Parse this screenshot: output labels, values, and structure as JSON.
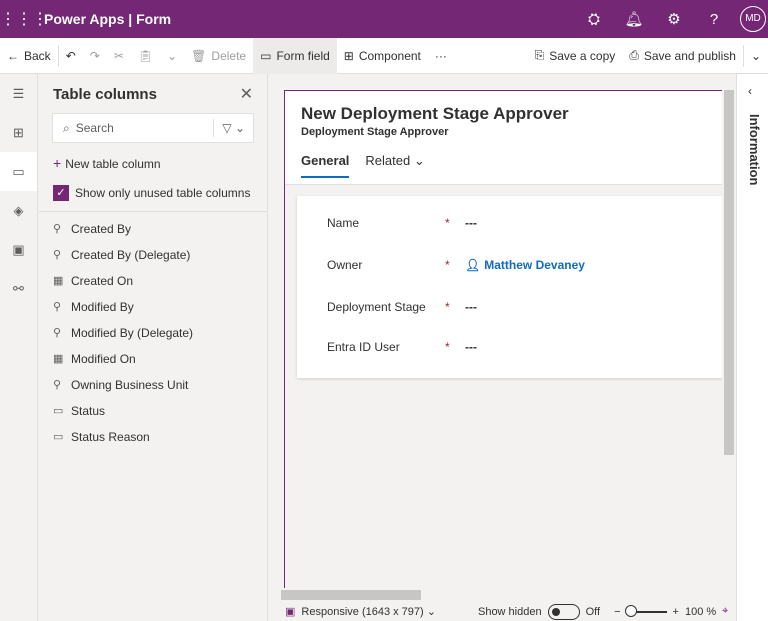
{
  "header": {
    "app": "Power Apps",
    "sep": "|",
    "page": "Form",
    "avatar": "MD"
  },
  "toolbar": {
    "back": "Back",
    "delete": "Delete",
    "form_field": "Form field",
    "component": "Component",
    "more": "···",
    "save_copy": "Save a copy",
    "save_publish": "Save and publish"
  },
  "panel": {
    "title": "Table columns",
    "search_placeholder": "Search",
    "new_column": "New table column",
    "show_unused": "Show only unused table columns",
    "columns": [
      {
        "label": "Created By",
        "icon": "lookup"
      },
      {
        "label": "Created By (Delegate)",
        "icon": "lookup"
      },
      {
        "label": "Created On",
        "icon": "date"
      },
      {
        "label": "Modified By",
        "icon": "lookup"
      },
      {
        "label": "Modified By (Delegate)",
        "icon": "lookup"
      },
      {
        "label": "Modified On",
        "icon": "date"
      },
      {
        "label": "Owning Business Unit",
        "icon": "lookup"
      },
      {
        "label": "Status",
        "icon": "option"
      },
      {
        "label": "Status Reason",
        "icon": "option"
      }
    ]
  },
  "form": {
    "title": "New Deployment Stage Approver",
    "subtitle": "Deployment Stage Approver",
    "tabs": [
      "General",
      "Related"
    ],
    "fields": [
      {
        "label": "Name",
        "value": "---"
      },
      {
        "label": "Owner",
        "value": "Matthew Devaney"
      },
      {
        "label": "Deployment Stage",
        "value": "---"
      },
      {
        "label": "Entra ID User",
        "value": "---"
      }
    ],
    "required": "*"
  },
  "info_label": "Information",
  "footer": {
    "responsive": "Responsive (1643 x 797)",
    "show_hidden": "Show hidden",
    "toggle": "Off",
    "zoom": "100 %"
  }
}
